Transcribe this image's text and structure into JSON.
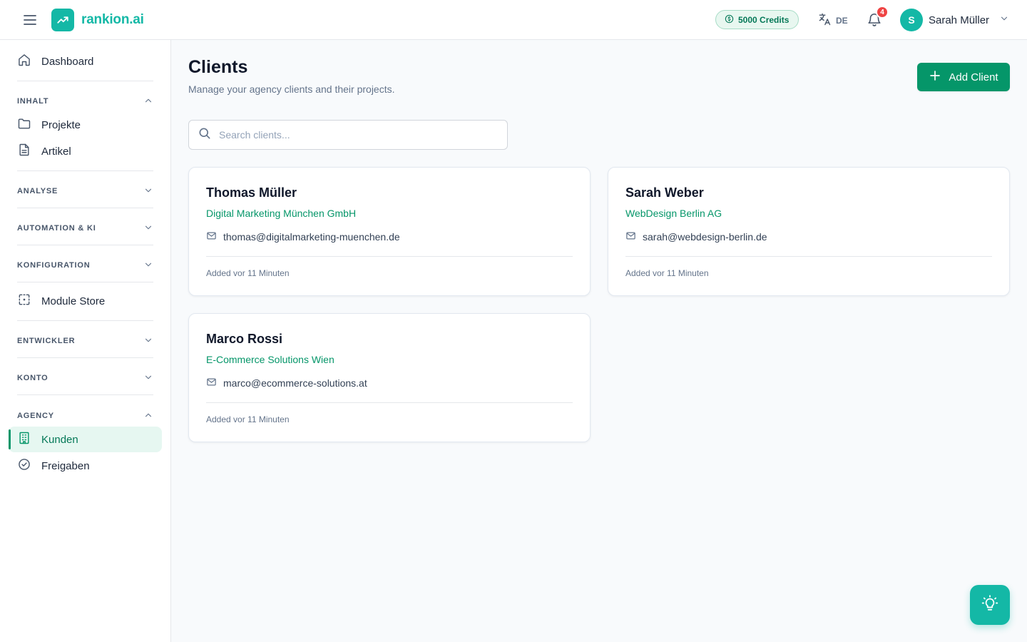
{
  "header": {
    "brand": "rankion.ai",
    "credits": "5000 Credits",
    "language": "DE",
    "notifications_count": "4",
    "user_initial": "S",
    "user_name": "Sarah Müller"
  },
  "sidebar": {
    "dashboard": "Dashboard",
    "sections": {
      "inhalt": "INHALT",
      "analyse": "ANALYSE",
      "automation": "AUTOMATION & KI",
      "konfiguration": "KONFIGURATION",
      "entwickler": "ENTWICKLER",
      "konto": "KONTO",
      "agency": "AGENCY"
    },
    "items": {
      "projekte": "Projekte",
      "artikel": "Artikel",
      "module_store": "Module Store",
      "kunden": "Kunden",
      "freigaben": "Freigaben"
    }
  },
  "main": {
    "title": "Clients",
    "subtitle": "Manage your agency clients and their projects.",
    "add_button": "Add Client",
    "search_placeholder": "Search clients..."
  },
  "clients": [
    {
      "name": "Thomas Müller",
      "company": "Digital Marketing München GmbH",
      "email": "thomas@digitalmarketing-muenchen.de",
      "added": "Added vor 11 Minuten"
    },
    {
      "name": "Sarah Weber",
      "company": "WebDesign Berlin AG",
      "email": "sarah@webdesign-berlin.de",
      "added": "Added vor 11 Minuten"
    },
    {
      "name": "Marco Rossi",
      "company": "E-Commerce Solutions Wien",
      "email": "marco@ecommerce-solutions.at",
      "added": "Added vor 11 Minuten"
    }
  ],
  "colors": {
    "brand": "#14b8a6",
    "accent": "#059669",
    "badge": "#ef4444"
  }
}
